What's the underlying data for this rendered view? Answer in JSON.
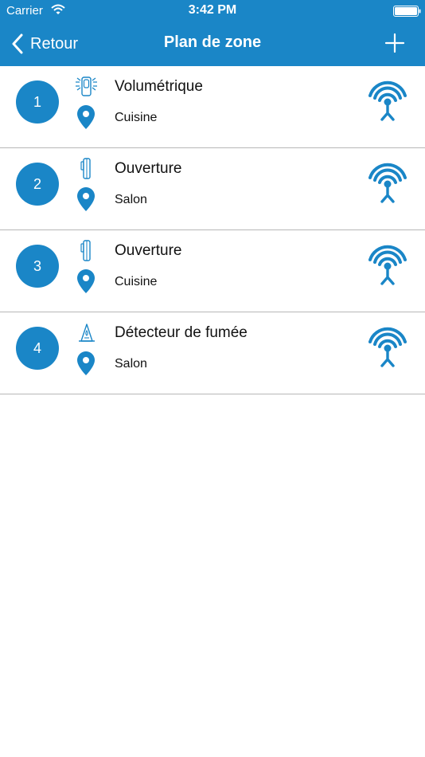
{
  "status_bar": {
    "carrier": "Carrier",
    "time": "3:42 PM"
  },
  "nav": {
    "back_label": "Retour",
    "title": "Plan de zone"
  },
  "colors": {
    "accent": "#1a86c7",
    "divider": "#b7b7b7"
  },
  "zones": [
    {
      "number": "1",
      "type": "Volumétrique",
      "type_icon": "motion-detector-icon",
      "location": "Cuisine",
      "status_icon": "signal-antenna-icon"
    },
    {
      "number": "2",
      "type": "Ouverture",
      "type_icon": "door-contact-icon",
      "location": "Salon",
      "status_icon": "signal-antenna-icon"
    },
    {
      "number": "3",
      "type": "Ouverture",
      "type_icon": "door-contact-icon",
      "location": "Cuisine",
      "status_icon": "signal-antenna-icon"
    },
    {
      "number": "4",
      "type": "Détecteur de fumée",
      "type_icon": "smoke-detector-icon",
      "location": "Salon",
      "status_icon": "signal-antenna-icon"
    }
  ]
}
